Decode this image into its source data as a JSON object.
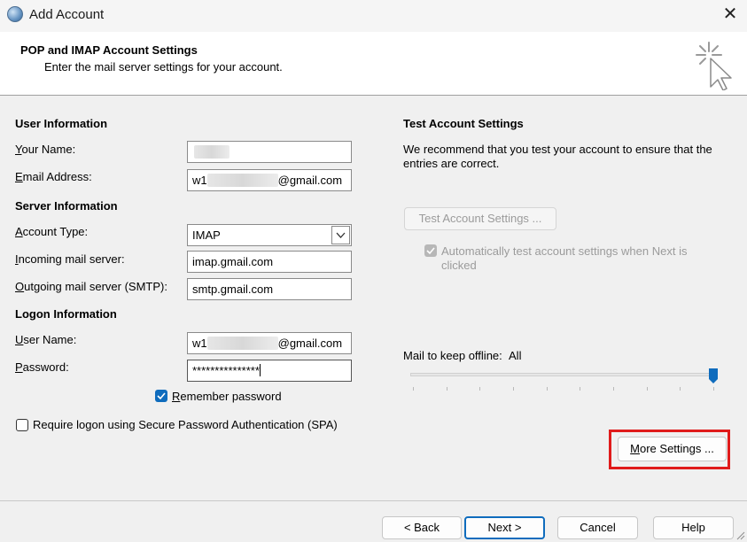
{
  "window": {
    "title": "Add Account",
    "close_symbol": "✕"
  },
  "header": {
    "title": "POP and IMAP Account Settings",
    "subtitle": "Enter the mail server settings for your account.",
    "icon": "cursor-sparkle-icon"
  },
  "user_info": {
    "heading": "User Information",
    "your_name": {
      "label": "Your Name:",
      "value": ""
    },
    "email_address": {
      "label": "Email Address:",
      "value_prefix": "w1",
      "value_suffix": "@gmail.com"
    }
  },
  "server_info": {
    "heading": "Server Information",
    "account_type": {
      "label": "Account Type:",
      "value": "IMAP"
    },
    "incoming": {
      "label": "Incoming mail server:",
      "value": "imap.gmail.com"
    },
    "outgoing": {
      "label": "Outgoing mail server (SMTP):",
      "value": "smtp.gmail.com"
    }
  },
  "logon_info": {
    "heading": "Logon Information",
    "user_name": {
      "label": "User Name:",
      "value_prefix": "w1",
      "value_suffix": "@gmail.com"
    },
    "password": {
      "label": "Password:",
      "value": "***************"
    },
    "remember_password": {
      "label": "Remember password",
      "checked": true
    },
    "spa": {
      "label": "Require logon using Secure Password Authentication (SPA)",
      "checked": false
    }
  },
  "test_settings": {
    "heading": "Test Account Settings",
    "description": "We recommend that you test your account to ensure that the entries are correct.",
    "test_button": "Test Account Settings ...",
    "auto_test": {
      "label": "Automatically test account settings when Next is clicked",
      "checked": true,
      "disabled": true
    }
  },
  "offline": {
    "label": "Mail to keep offline:",
    "value": "All",
    "slider_level": 1.0
  },
  "more_settings_button": "More Settings ...",
  "footer": {
    "back": "< Back",
    "next": "Next >",
    "cancel": "Cancel",
    "help": "Help"
  },
  "colors": {
    "accent": "#0f6cbd",
    "highlight_box": "#e01b1b"
  }
}
